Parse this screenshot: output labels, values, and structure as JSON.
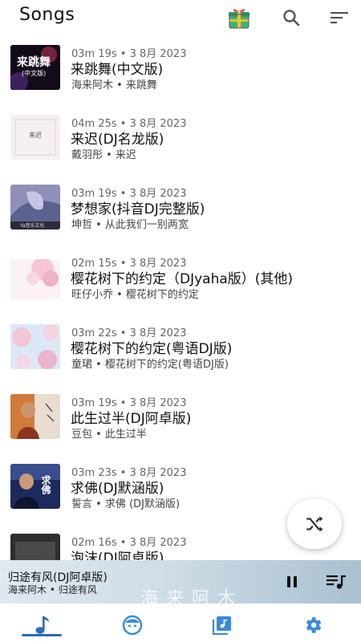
{
  "header": {
    "title": "Songs"
  },
  "songs": [
    {
      "meta": "03m 19s  •  3 8月 2023",
      "title": "来跳舞(中文版)",
      "artist": "海来阿木  •  来跳舞"
    },
    {
      "meta": "04m 25s  •  3 8月 2023",
      "title": "来迟(DJ名龙版)",
      "artist": "戴羽彤  •  来迟"
    },
    {
      "meta": "03m 19s  •  3 8月 2023",
      "title": "梦想家(抖音DJ完整版)",
      "artist": "坤哲  •  从此我们一别两宽"
    },
    {
      "meta": "02m 15s  •  3 8月 2023",
      "title": "樱花树下的约定（DJyaha版）(其他)",
      "artist": "旺仔小乔  •  樱花树下的约定"
    },
    {
      "meta": "03m 22s  •  3 8月 2023",
      "title": "樱花树下的约定(粤语DJ版)",
      "artist": "童珺  •  樱花树下的约定(粤语DJ版)"
    },
    {
      "meta": "03m 19s  •  3 8月 2023",
      "title": "此生过半(DJ阿卓版)",
      "artist": "豆包  •  此生过半"
    },
    {
      "meta": "03m 23s  •  3 8月 2023",
      "title": "求佛(DJ默涵版)",
      "artist": "誓言  •  求佛 (DJ默涵版)"
    },
    {
      "meta": "02m 16s  •  3 8月 2023",
      "title": "泡沫(DJ阿卓版)",
      "artist": ""
    }
  ],
  "thumbs": {
    "t0": "来跳舞",
    "t0sub": "(中文版)",
    "t1": "来迟",
    "t2": "Ya音乐文化",
    "t6": "求佛"
  },
  "player": {
    "title": "归途有风(DJ阿卓版)",
    "artist": "海来阿木  •  归途有风",
    "art_text": "海来阿木"
  },
  "colors": {
    "accent": "#2a6bbd",
    "nav_icon": "#3b8ad9"
  },
  "icons": [
    "gift-icon",
    "search-icon",
    "sort-icon",
    "shuffle-icon",
    "pause-icon",
    "queue-music-icon",
    "music-note-icon",
    "artist-icon",
    "album-icon",
    "settings-icon"
  ]
}
